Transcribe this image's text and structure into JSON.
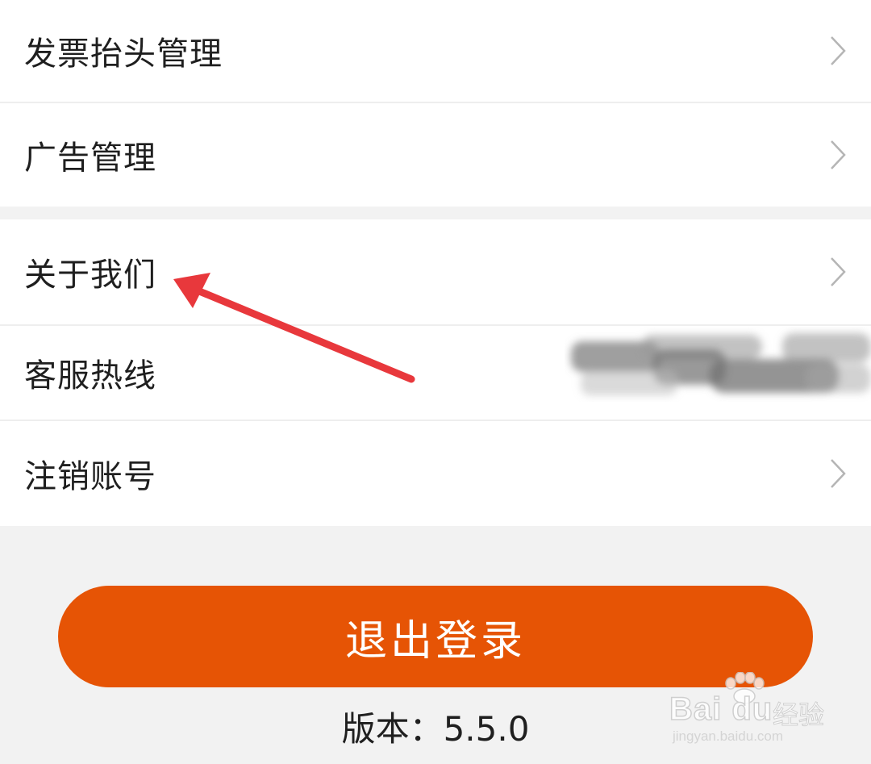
{
  "menu": {
    "group1": [
      {
        "label": "发票抬头管理",
        "icon": "chevron-right-icon"
      },
      {
        "label": "广告管理",
        "icon": "chevron-right-icon"
      }
    ],
    "group2": [
      {
        "label": "关于我们",
        "icon": "chevron-right-icon"
      },
      {
        "label": "客服热线",
        "value": "",
        "value_redacted": true
      },
      {
        "label": "注销账号",
        "icon": "chevron-right-icon"
      }
    ]
  },
  "logout_label": "退出登录",
  "version_text": "版本：5.5.0",
  "watermark": {
    "brand": "Bai du",
    "sub": "经验",
    "url": "jingyan.baidu.com"
  },
  "colors": {
    "accent": "#e65405",
    "arrow": "#e8383c",
    "background": "#f2f2f2",
    "row": "#ffffff",
    "text": "#1f1f1f"
  }
}
